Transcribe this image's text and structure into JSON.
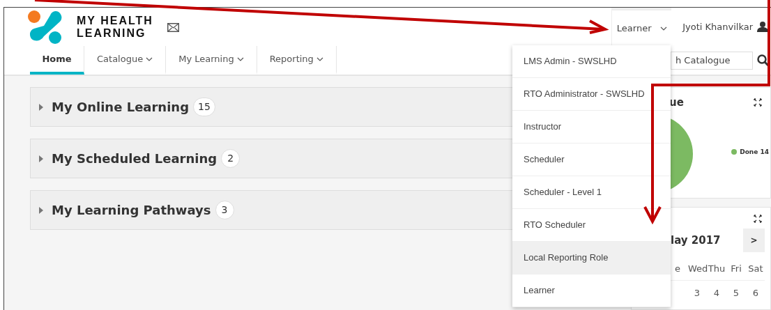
{
  "logo": {
    "line_1": "MY HEALTH",
    "line_2": "LEARNING"
  },
  "role_menu": {
    "label": "Learner",
    "open": true
  },
  "user": {
    "name": "Jyoti Khanvilkar"
  },
  "nav": [
    {
      "label": "Home",
      "selected": true,
      "dropdown": false
    },
    {
      "label": "Catalogue",
      "selected": false,
      "dropdown": true
    },
    {
      "label": "My Learning",
      "selected": false,
      "dropdown": true
    },
    {
      "label": "Reporting",
      "selected": false,
      "dropdown": true
    }
  ],
  "search": {
    "placeholder": "h Catalogue"
  },
  "sections": [
    {
      "title": "My Online Learning",
      "count": "15"
    },
    {
      "title": "My Scheduled Learning",
      "count": "2"
    },
    {
      "title": "My Learning Pathways",
      "count": "3"
    }
  ],
  "status_widget": {
    "title": "ue",
    "legend": "Done 14",
    "color": "#7cba62"
  },
  "calendar_widget": {
    "month": "lay 2017",
    "next": ">",
    "weekdays": [
      "e",
      "Wed",
      "Thu",
      "Fri",
      "Sat"
    ],
    "days": [
      "3",
      "4",
      "5",
      "6"
    ]
  },
  "role_options": [
    {
      "label": "LMS Admin - SWSLHD",
      "selected": false
    },
    {
      "label": "RTO Administrator - SWSLHD",
      "selected": false
    },
    {
      "label": "Instructor",
      "selected": false
    },
    {
      "label": "Scheduler",
      "selected": false
    },
    {
      "label": "Scheduler - Level 1",
      "selected": false
    },
    {
      "label": "RTO Scheduler",
      "selected": false
    },
    {
      "label": "Local Reporting Role",
      "selected": true
    },
    {
      "label": "Learner",
      "selected": false
    }
  ]
}
